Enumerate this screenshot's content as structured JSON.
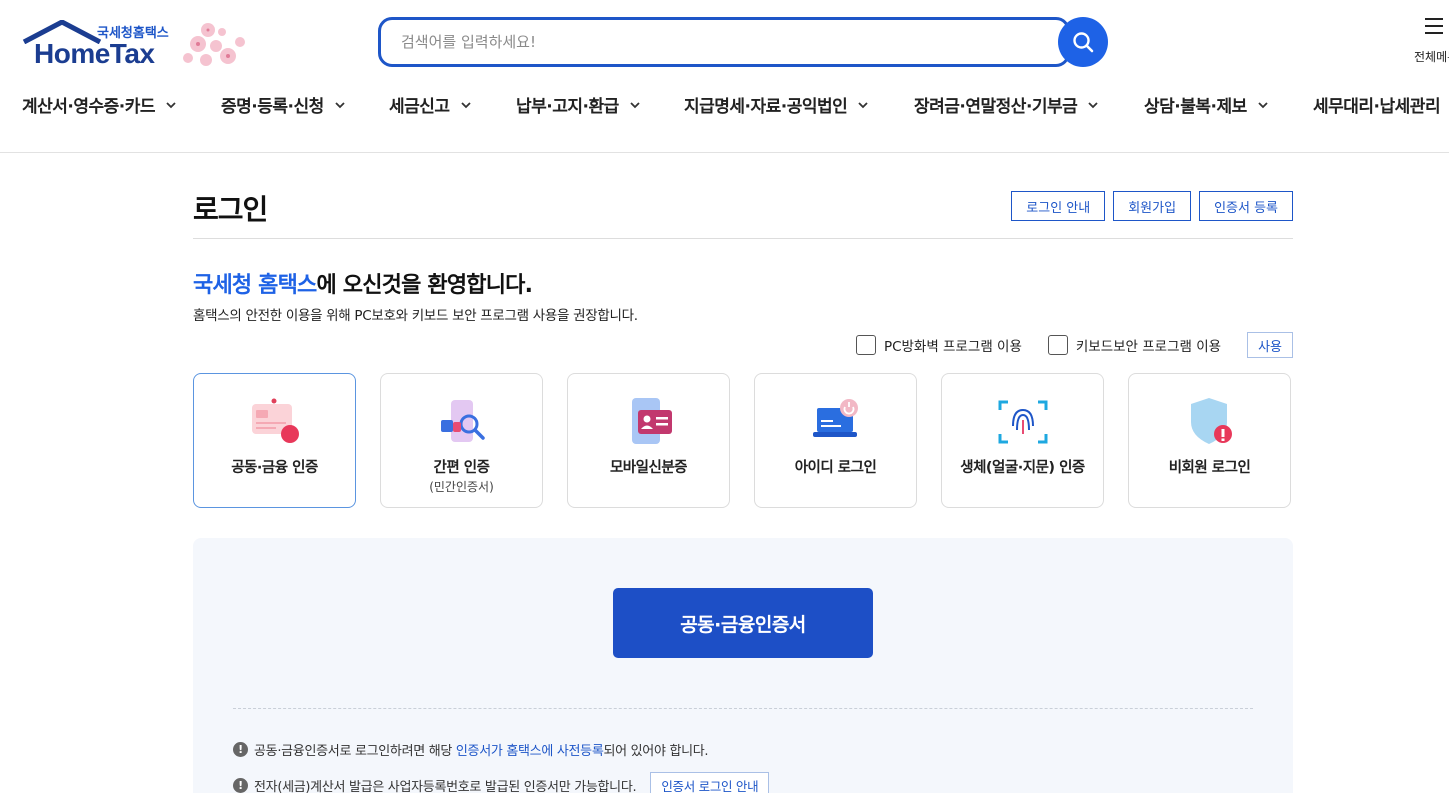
{
  "header": {
    "logo_kr": "국세청홈택스",
    "logo_en": "HomeTax",
    "search_placeholder": "검색어를 입력하세요!",
    "allmenu_label": "전체메뉴"
  },
  "nav": {
    "items": [
      {
        "label": "계산서·영수증·카드"
      },
      {
        "label": "증명·등록·신청"
      },
      {
        "label": "세금신고"
      },
      {
        "label": "납부·고지·환급"
      },
      {
        "label": "지급명세·자료·공익법인"
      },
      {
        "label": "장려금·연말정산·기부금"
      },
      {
        "label": "상담·불복·제보"
      },
      {
        "label": "세무대리·납세관리"
      }
    ]
  },
  "page": {
    "title": "로그인",
    "buttons": {
      "login_guide": "로그인 안내",
      "signup": "회원가입",
      "cert_register": "인증서 등록"
    },
    "welcome_hl": "국세청 홈택스",
    "welcome_rest": "에 오신것을 환영합니다.",
    "notice": "홈택스의 안전한 이용을 위해 PC보호와 키보드 보안 프로그램 사용을 권장합니다.",
    "options": {
      "firewall": "PC방화벽 프로그램 이용",
      "keyboard": "키보드보안 프로그램 이용",
      "use": "사용"
    }
  },
  "login_methods": [
    {
      "label": "공동·금융 인증",
      "sub": "",
      "icon": "certificate-card-icon",
      "active": true
    },
    {
      "label": "간편 인증",
      "sub": "(민간인증서)",
      "icon": "simple-auth-phone-icon",
      "active": false
    },
    {
      "label": "모바일신분증",
      "sub": "",
      "icon": "mobile-id-icon",
      "active": false
    },
    {
      "label": "아이디 로그인",
      "sub": "",
      "icon": "laptop-power-icon",
      "active": false
    },
    {
      "label": "생체(얼굴·지문) 인증",
      "sub": "",
      "icon": "fingerprint-icon",
      "active": false
    },
    {
      "label": "비회원 로그인",
      "sub": "",
      "icon": "shield-guest-icon",
      "active": false
    }
  ],
  "panel": {
    "main_button": "공동·금융인증서",
    "info1_pre": "공동·금융인증서로 로그인하려면 해당 ",
    "info1_link": "인증서가 홈택스에 사전등록",
    "info1_post": "되어 있어야 합니다.",
    "info2": "전자(세금)계산서 발급은 사업자등록번호로 발급된 인증서만 가능합니다.",
    "info2_button": "인증서 로그인 안내"
  },
  "colors": {
    "brand_blue": "#1e56c8",
    "search_blue": "#1e62e6",
    "main_button": "#1d4fc6",
    "panel_bg": "#f4f7fc"
  }
}
